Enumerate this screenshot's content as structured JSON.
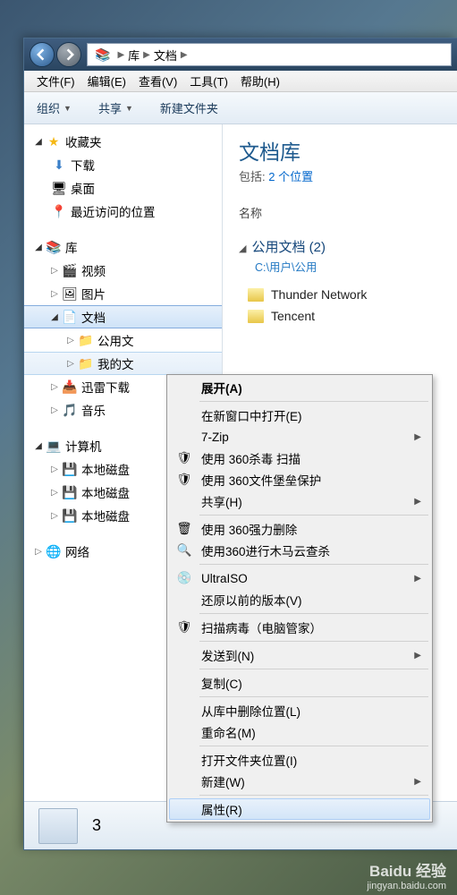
{
  "breadcrumb": {
    "root": "库",
    "current": "文档"
  },
  "menubar": {
    "file": "文件(F)",
    "edit": "编辑(E)",
    "view": "查看(V)",
    "tools": "工具(T)",
    "help": "帮助(H)"
  },
  "toolbar": {
    "organize": "组织",
    "share": "共享",
    "newfolder": "新建文件夹"
  },
  "sidebar": {
    "favorites": "收藏夹",
    "downloads": "下载",
    "desktop": "桌面",
    "recent": "最近访问的位置",
    "libraries": "库",
    "videos": "视频",
    "pictures": "图片",
    "documents": "文档",
    "pub_docs": "公用文",
    "my_docs": "我的文",
    "xunlei": "迅雷下载",
    "music": "音乐",
    "computer": "计算机",
    "disk1": "本地磁盘",
    "disk2": "本地磁盘",
    "disk3": "本地磁盘",
    "network": "网络"
  },
  "main": {
    "title": "文档库",
    "sub_prefix": "包括:",
    "sub_link": "2 个位置",
    "col_name": "名称",
    "group_name": "公用文档 (2)",
    "group_path": "C:\\用户\\公用",
    "files": [
      "Thunder Network",
      "Tencent"
    ]
  },
  "ctx": {
    "expand": "展开(A)",
    "open_new": "在新窗口中打开(E)",
    "sevenzip": "7-Zip",
    "scan360": "使用 360杀毒 扫描",
    "fortress": "使用 360文件堡垒保护",
    "sharemenu": "共享(H)",
    "forcedel": "使用 360强力删除",
    "trojan": "使用360进行木马云查杀",
    "ultraiso": "UltraISO",
    "restore": "还原以前的版本(V)",
    "scanvirus": "扫描病毒（电脑管家）",
    "sendto": "发送到(N)",
    "copy": "复制(C)",
    "remove": "从库中删除位置(L)",
    "rename": "重命名(M)",
    "openloc": "打开文件夹位置(I)",
    "new": "新建(W)",
    "props": "属性(R)"
  },
  "status": {
    "count": "3"
  },
  "watermark": {
    "brand": "Baidu 经验",
    "url": "jingyan.baidu.com"
  }
}
